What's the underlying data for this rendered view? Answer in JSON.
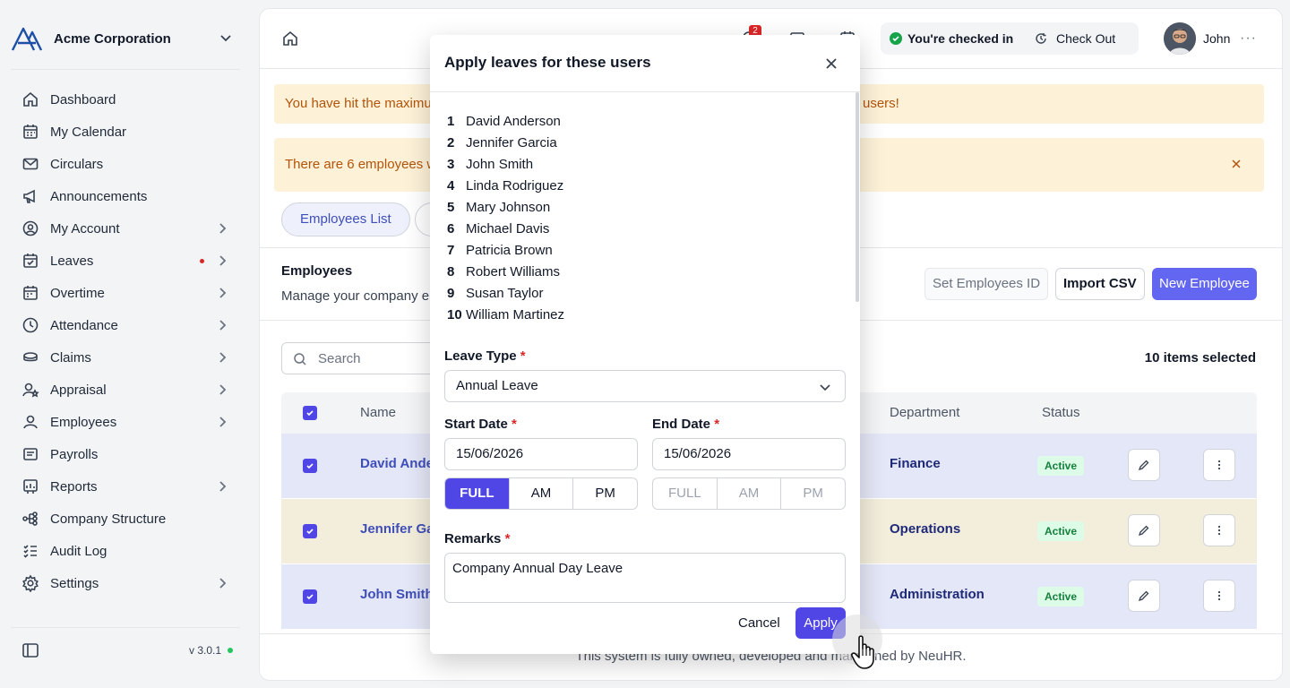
{
  "sidebar": {
    "org_name": "Acme Corporation",
    "items": [
      {
        "label": "Dashboard",
        "icon": "home-icon"
      },
      {
        "label": "My Calendar",
        "icon": "calendar-icon"
      },
      {
        "label": "Circulars",
        "icon": "mail-icon"
      },
      {
        "label": "Announcements",
        "icon": "megaphone-icon"
      },
      {
        "label": "My Account",
        "icon": "user-circle-icon"
      },
      {
        "label": "Leaves",
        "icon": "calendar-check-icon"
      },
      {
        "label": "Overtime",
        "icon": "calendar-plus-icon"
      },
      {
        "label": "Attendance",
        "icon": "clock-icon"
      },
      {
        "label": "Claims",
        "icon": "coins-icon"
      },
      {
        "label": "Appraisal",
        "icon": "user-star-icon"
      },
      {
        "label": "Employees",
        "icon": "user-icon"
      },
      {
        "label": "Payrolls",
        "icon": "receipt-icon"
      },
      {
        "label": "Reports",
        "icon": "report-icon"
      },
      {
        "label": "Company Structure",
        "icon": "hierarchy-icon"
      },
      {
        "label": "Audit Log",
        "icon": "list-check-icon"
      },
      {
        "label": "Settings",
        "icon": "gear-icon"
      }
    ],
    "version": "v 3.0.1"
  },
  "topbar": {
    "notification_count": "2",
    "checked_in_text": "You're checked in",
    "checkout_label": "Check Out",
    "user_name": "John",
    "more": "···"
  },
  "alerts": {
    "max_users_start": "You have hit the maximum",
    "max_users_end": "users!",
    "employees_warning": "There are 6 employees w"
  },
  "tabs": {
    "employees_list": "Employees List"
  },
  "employees": {
    "title": "Employees",
    "subtitle": "Manage your company em",
    "set_id_label": "Set Employees ID",
    "import_label": "Import CSV",
    "new_label": "New Employee",
    "search_placeholder": "Search",
    "selected_count": "10 items selected",
    "columns": {
      "name": "Name",
      "department": "Department",
      "status": "Status"
    },
    "rows": [
      {
        "name": "David Ander",
        "department": "Finance",
        "status": "Active"
      },
      {
        "name": "Jennifer Gar",
        "department": "Operations",
        "status": "Active"
      },
      {
        "name": "John Smith",
        "department": "Administration",
        "status": "Active"
      }
    ]
  },
  "footer": {
    "text": "This system is fully owned, developed and maintained by NeuHR."
  },
  "modal": {
    "title": "Apply leaves for these users",
    "users": [
      {
        "n": "1",
        "name": "David Anderson"
      },
      {
        "n": "2",
        "name": "Jennifer Garcia"
      },
      {
        "n": "3",
        "name": "John Smith"
      },
      {
        "n": "4",
        "name": "Linda Rodriguez"
      },
      {
        "n": "5",
        "name": "Mary Johnson"
      },
      {
        "n": "6",
        "name": "Michael Davis"
      },
      {
        "n": "7",
        "name": "Patricia Brown"
      },
      {
        "n": "8",
        "name": "Robert Williams"
      },
      {
        "n": "9",
        "name": "Susan Taylor"
      },
      {
        "n": "10",
        "name": "William Martinez"
      }
    ],
    "leave_type_label": "Leave Type",
    "leave_type_value": "Annual Leave",
    "start_date_label": "Start Date",
    "start_date_value": "15/06/2026",
    "end_date_label": "End Date",
    "end_date_value": "15/06/2026",
    "segments": [
      "FULL",
      "AM",
      "PM"
    ],
    "remarks_label": "Remarks",
    "remarks_value": "Company Annual Day Leave",
    "required_mark": "*",
    "cancel_label": "Cancel",
    "apply_label": "Apply"
  },
  "colors": {
    "primary": "#4f46e5",
    "warning_bg": "#fdf2d8",
    "warning_text": "#b45309",
    "active_green": "#15803d"
  }
}
